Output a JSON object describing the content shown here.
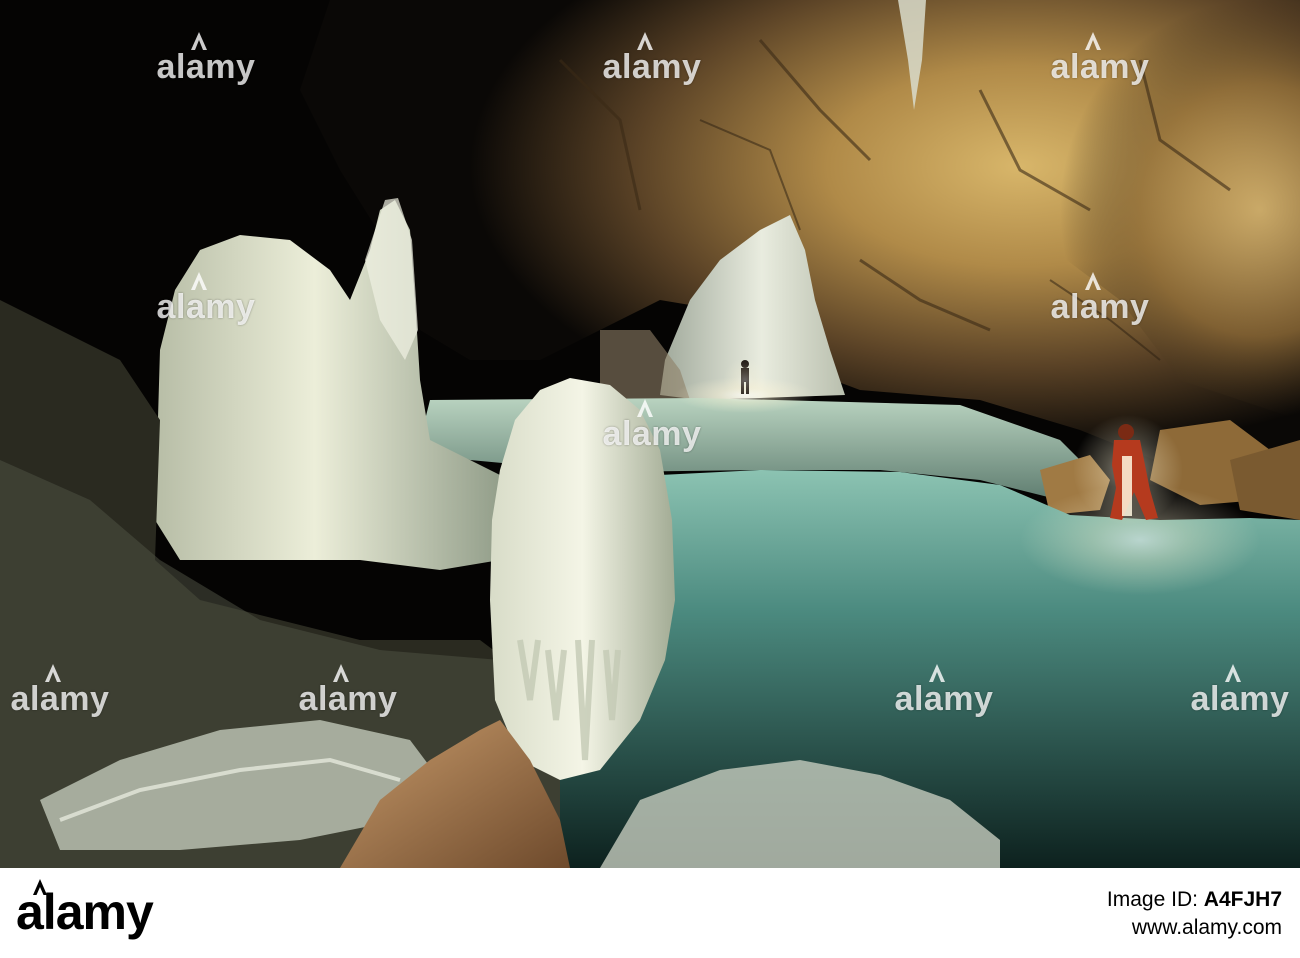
{
  "watermark": {
    "text": "alamy",
    "icon": "alamy-a-icon",
    "color": "#ffffff"
  },
  "footer": {
    "logo_text": "alamy",
    "image_id_label": "Image ID:",
    "image_id": "A4FJH7",
    "site_url": "www.alamy.com"
  },
  "scene": {
    "palette": {
      "shadow": "#050403",
      "rock_lit": "#c09a52",
      "rock_mid": "#7a5e32",
      "ice": "#e6e8d8",
      "ice_shadow": "#8a9a84",
      "water": "#4e8f84",
      "caver_suit": "#b53a1e"
    }
  }
}
